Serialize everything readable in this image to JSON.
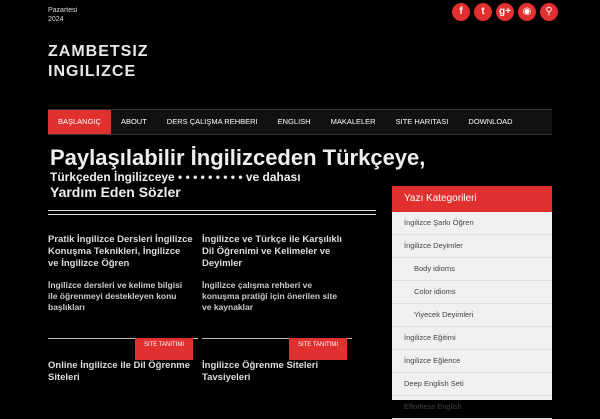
{
  "topdate": {
    "line1": "Pazartesi",
    "line2": "2024"
  },
  "social": [
    {
      "icon": "facebook-icon",
      "glyph": "f"
    },
    {
      "icon": "twitter-icon",
      "glyph": "t"
    },
    {
      "icon": "google-plus-icon",
      "glyph": "g+"
    },
    {
      "icon": "rss-icon",
      "glyph": "◉"
    },
    {
      "icon": "search-icon",
      "glyph": "⚲"
    }
  ],
  "logo": {
    "line1": "ZAMBETSIZ",
    "line2": "INGILIZCE"
  },
  "nav": [
    {
      "label": "BAŞLANGIÇ",
      "active": true
    },
    {
      "label": "ABOUT"
    },
    {
      "label": "DERS ÇALIŞMA REHBERI"
    },
    {
      "label": "ENGLISH"
    },
    {
      "label": "MAKALELER"
    },
    {
      "label": "SITE HARITASI"
    },
    {
      "label": "DOWNLOAD"
    }
  ],
  "headline": {
    "line1": "Paylaşılabilir İngilizceden Türkçeye,",
    "line2": "Türkçeden İngilizceye • • • • • • • • • ve dahası",
    "line3": "Yardım Eden Sözler"
  },
  "posts": [
    {
      "title": "Pratik İngilizce Dersleri İngilizce Konuşma Teknikleri, İngilizce ve İngilizce Öğren",
      "excerpt": "İngilizce dersleri ve kelime bilgisi ile öğrenmeyi destekleyen konu başlıkları",
      "badge": "SITE TANITIMI"
    },
    {
      "title": "İngilizce ve Türkçe ile Karşılıklı Dil Öğrenimi ve Kelimeler ve Deyimler",
      "excerpt": "İngilizce çalışma rehberi ve konuşma pratiği için önerilen site ve kaynaklar",
      "badge": "SITE TANITIMI"
    }
  ],
  "posts2": [
    {
      "title": "Online İngilizce ile Dil Öğrenme Siteleri"
    },
    {
      "title": "İngilizce Öğrenme Siteleri Tavsiyeleri"
    }
  ],
  "sidebar": {
    "title": "Yazı Kategorileri",
    "categories": [
      {
        "label": "İngilizce Şarkı Öğren",
        "sub": false
      },
      {
        "label": "İngilizce Deyimler",
        "sub": false
      },
      {
        "label": "Body idioms",
        "sub": true
      },
      {
        "label": "Color idioms",
        "sub": true
      },
      {
        "label": "Yiyecek Deyimleri",
        "sub": true
      },
      {
        "label": "İngilizce Eğitimi",
        "sub": false
      },
      {
        "label": "İngilizce Eğlence",
        "sub": false
      },
      {
        "label": "Deep English Seti",
        "sub": false
      },
      {
        "label": "Effortless English",
        "sub": false
      }
    ]
  },
  "colors": {
    "accent": "#e03030",
    "bg": "#000000",
    "sidebar_bg": "#f0f0f0"
  }
}
